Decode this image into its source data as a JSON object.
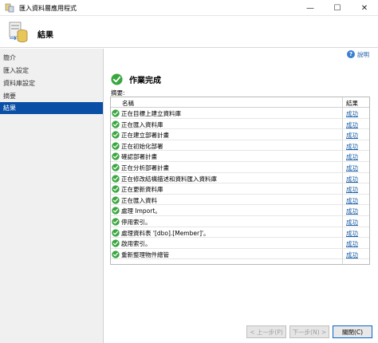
{
  "window": {
    "title": "匯入資料層應用程式",
    "minimize_glyph": "—",
    "maximize_glyph": "☐",
    "close_glyph": "✕"
  },
  "header": {
    "title": "結果"
  },
  "sidebar": {
    "items": [
      {
        "label": "簡介"
      },
      {
        "label": "匯入設定"
      },
      {
        "label": "資料庫設定"
      },
      {
        "label": "摘要"
      },
      {
        "label": "結果",
        "active": true
      }
    ]
  },
  "help": {
    "label": "說明"
  },
  "status": {
    "title": "作業完成"
  },
  "summary_label": "摘要:",
  "table": {
    "columns": {
      "name": "名稱",
      "result": "結果"
    },
    "rows": [
      {
        "name": "正在目標上建立資料庫",
        "result": "成功"
      },
      {
        "name": "正在匯入資料庫",
        "result": "成功"
      },
      {
        "name": "正在建立部署計畫",
        "result": "成功"
      },
      {
        "name": "正在初始化部署",
        "result": "成功"
      },
      {
        "name": "確認部署計畫",
        "result": "成功"
      },
      {
        "name": "正在分析部署計畫",
        "result": "成功"
      },
      {
        "name": "正在修改結構描述和資料匯入資料庫",
        "result": "成功"
      },
      {
        "name": "正在更新資料庫",
        "result": "成功"
      },
      {
        "name": "正在匯入資料",
        "result": "成功"
      },
      {
        "name": "處理 Import。",
        "result": "成功"
      },
      {
        "name": "停用索引。",
        "result": "成功"
      },
      {
        "name": "處理資料表 '[dbo].[Member]'。",
        "result": "成功"
      },
      {
        "name": "啟用索引。",
        "result": "成功"
      },
      {
        "name": "重新整理物件總管",
        "result": "成功"
      }
    ]
  },
  "buttons": {
    "previous": "< 上一步(P)",
    "next": "下一步(N) >",
    "close": "關閉(C)"
  },
  "colors": {
    "accent": "#0a4fa6",
    "success": "#3aa640",
    "link": "#1a5fa8"
  }
}
